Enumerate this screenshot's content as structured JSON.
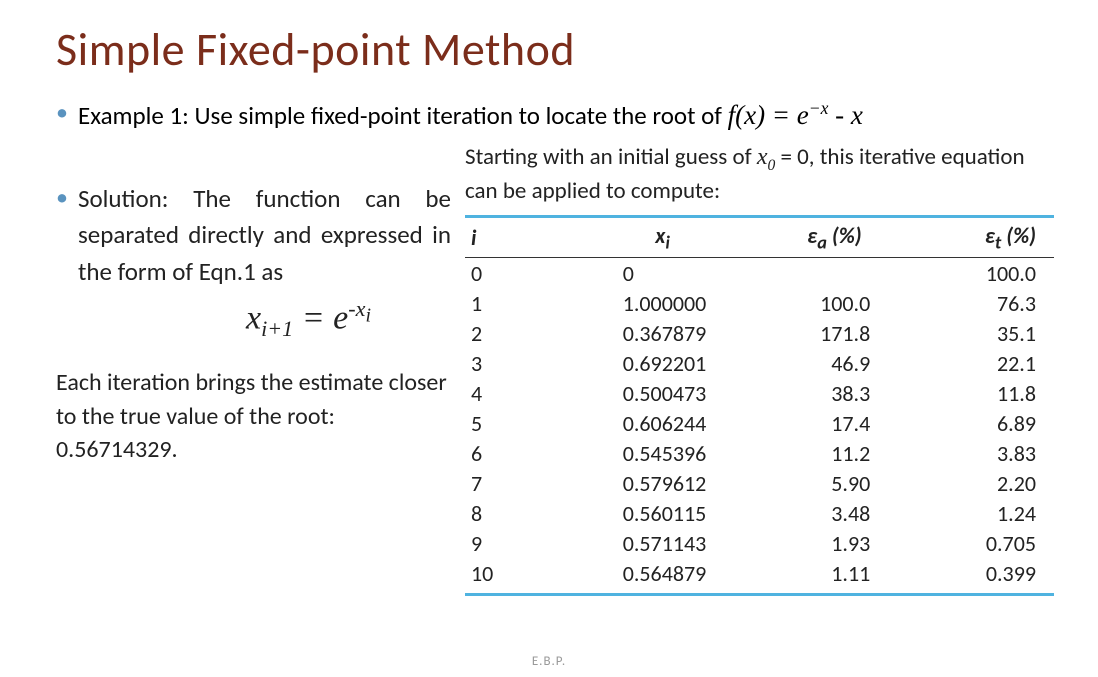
{
  "title": "Simple Fixed-point Method",
  "example": {
    "prefix": "Example 1: Use simple fixed-point iteration to locate the root of  ",
    "fx_html": "f(x) = e−x - x"
  },
  "solution_bullet": "Solution: The function can be separated directly and expressed in the form of Eqn.1 as",
  "iter_eq_html": "x_{i+1} = e^{-x_i}",
  "starting_text": "Starting with an initial guess of x₀ = 0, this iterative equation can be applied to compute:",
  "table": {
    "headers": {
      "i": "i",
      "xi": "xᵢ",
      "ea": "εₐ (%)",
      "et": "εₜ (%)"
    },
    "rows": [
      {
        "i": "0",
        "xi": "0",
        "ea": "",
        "et": "100.0"
      },
      {
        "i": "1",
        "xi": "1.000000",
        "ea": "100.0",
        "et": "76.3"
      },
      {
        "i": "2",
        "xi": "0.367879",
        "ea": "171.8",
        "et": "35.1"
      },
      {
        "i": "3",
        "xi": "0.692201",
        "ea": "46.9",
        "et": "22.1"
      },
      {
        "i": "4",
        "xi": "0.500473",
        "ea": "38.3",
        "et": "11.8"
      },
      {
        "i": "5",
        "xi": "0.606244",
        "ea": "17.4",
        "et": "6.89"
      },
      {
        "i": "6",
        "xi": "0.545396",
        "ea": "11.2",
        "et": "3.83"
      },
      {
        "i": "7",
        "xi": "0.579612",
        "ea": "5.90",
        "et": "2.20"
      },
      {
        "i": "8",
        "xi": "0.560115",
        "ea": "3.48",
        "et": "1.24"
      },
      {
        "i": "9",
        "xi": "0.571143",
        "ea": "1.93",
        "et": "0.705"
      },
      {
        "i": "10",
        "xi": "0.564879",
        "ea": "1.11",
        "et": "0.399"
      }
    ]
  },
  "convergence_text": "Each iteration brings the estimate closer to the true value of the root: 0.56714329.",
  "footer": "E.B.P."
}
